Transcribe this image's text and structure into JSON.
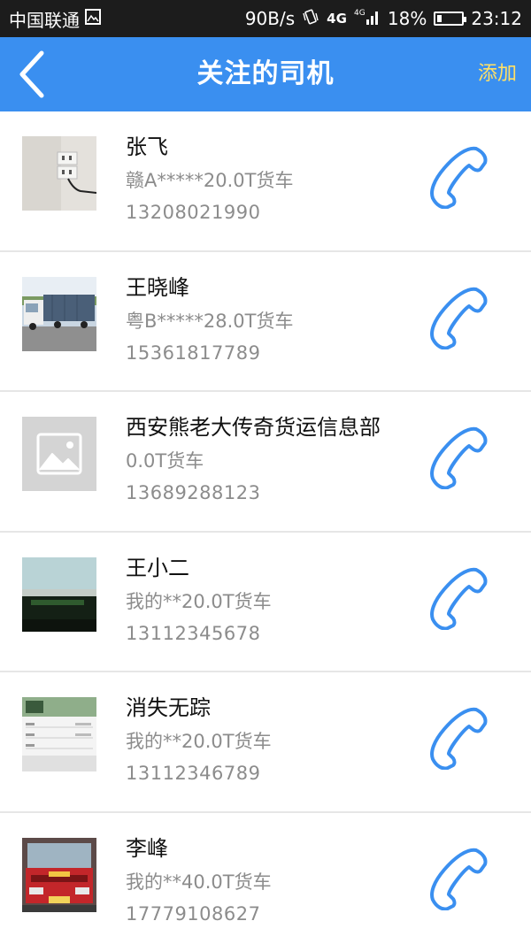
{
  "status_bar": {
    "carrier": "中国联通",
    "speed": "90B/s",
    "network": "4G",
    "battery": "18%",
    "battery_level": 0.18,
    "time": "23:12"
  },
  "header": {
    "title": "关注的司机",
    "add_label": "添加",
    "back_icon": "back-chevron-icon"
  },
  "colors": {
    "header_bg": "#3a8ff0",
    "add_text": "#ffe066",
    "call_icon": "#3a8ff0"
  },
  "drivers": [
    {
      "name": "张飞",
      "truck": "赣A*****20.0T货车",
      "phone": "13208021990",
      "thumb": "wall-outlet-photo"
    },
    {
      "name": "王晓峰",
      "truck": "粤B*****28.0T货车",
      "phone": "15361817789",
      "thumb": "container-truck-photo"
    },
    {
      "name": "西安熊老大传奇货运信息部",
      "truck": "0.0T货车",
      "phone": "13689288123",
      "thumb": "placeholder-image-icon"
    },
    {
      "name": "王小二",
      "truck": "我的**20.0T货车",
      "phone": "13112345678",
      "thumb": "dark-room-photo"
    },
    {
      "name": "消失无踪",
      "truck": "我的**20.0T货车",
      "phone": "13112346789",
      "thumb": "screenshot-photo"
    },
    {
      "name": "李峰",
      "truck": "我的**40.0T货车",
      "phone": "17779108627",
      "thumb": "red-truck-photo"
    }
  ]
}
